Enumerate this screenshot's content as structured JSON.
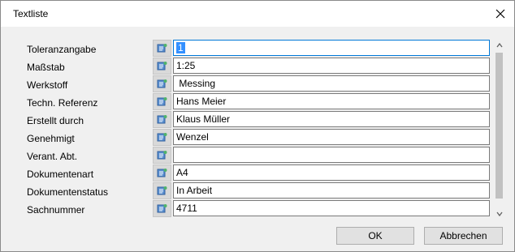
{
  "window": {
    "title": "Textliste"
  },
  "rows": [
    {
      "label": "Toleranzangabe",
      "value": "1"
    },
    {
      "label": "Maßstab",
      "value": "1:25"
    },
    {
      "label": "Werkstoff",
      "value": " Messing"
    },
    {
      "label": "Techn. Referenz",
      "value": "Hans Meier"
    },
    {
      "label": "Erstellt durch",
      "value": "Klaus Müller"
    },
    {
      "label": "Genehmigt",
      "value": "Wenzel"
    },
    {
      "label": "Verant. Abt.",
      "value": ""
    },
    {
      "label": "Dokumentenart",
      "value": "A4"
    },
    {
      "label": "Dokumentenstatus",
      "value": "In Arbeit"
    },
    {
      "label": "Sachnummer",
      "value": "4711"
    }
  ],
  "buttons": {
    "ok": "OK",
    "cancel": "Abbrechen"
  },
  "colors": {
    "focus_border": "#0078d7",
    "selection": "#3390ff"
  },
  "icons": {
    "row_button": "text-list-icon",
    "close": "close-icon"
  }
}
